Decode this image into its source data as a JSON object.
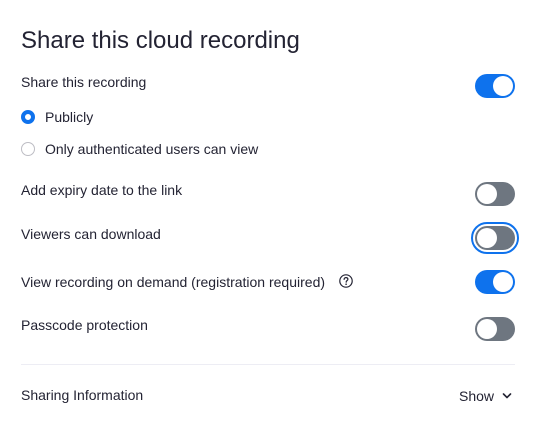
{
  "dialog": {
    "title": "Share this cloud recording"
  },
  "settings": {
    "share_recording": {
      "label": "Share this recording",
      "enabled": true
    },
    "visibility": {
      "options": [
        {
          "label": "Publicly",
          "selected": true
        },
        {
          "label": "Only authenticated users can view",
          "selected": false
        }
      ]
    },
    "expiry_date": {
      "label": "Add expiry date to the link",
      "enabled": false
    },
    "viewers_download": {
      "label": "Viewers can download",
      "enabled": false,
      "focused": true
    },
    "on_demand": {
      "label": "View recording on demand (registration required)",
      "enabled": true,
      "help_icon": "question-circle-icon"
    },
    "passcode": {
      "label": "Passcode protection",
      "enabled": false
    }
  },
  "sharing_info": {
    "label": "Sharing Information",
    "show_label": "Show",
    "icon": "chevron-down-icon"
  },
  "colors": {
    "accent": "#0e72ed",
    "toggle_off": "#6e7680",
    "text": "#232333",
    "divider": "#ededf4"
  }
}
